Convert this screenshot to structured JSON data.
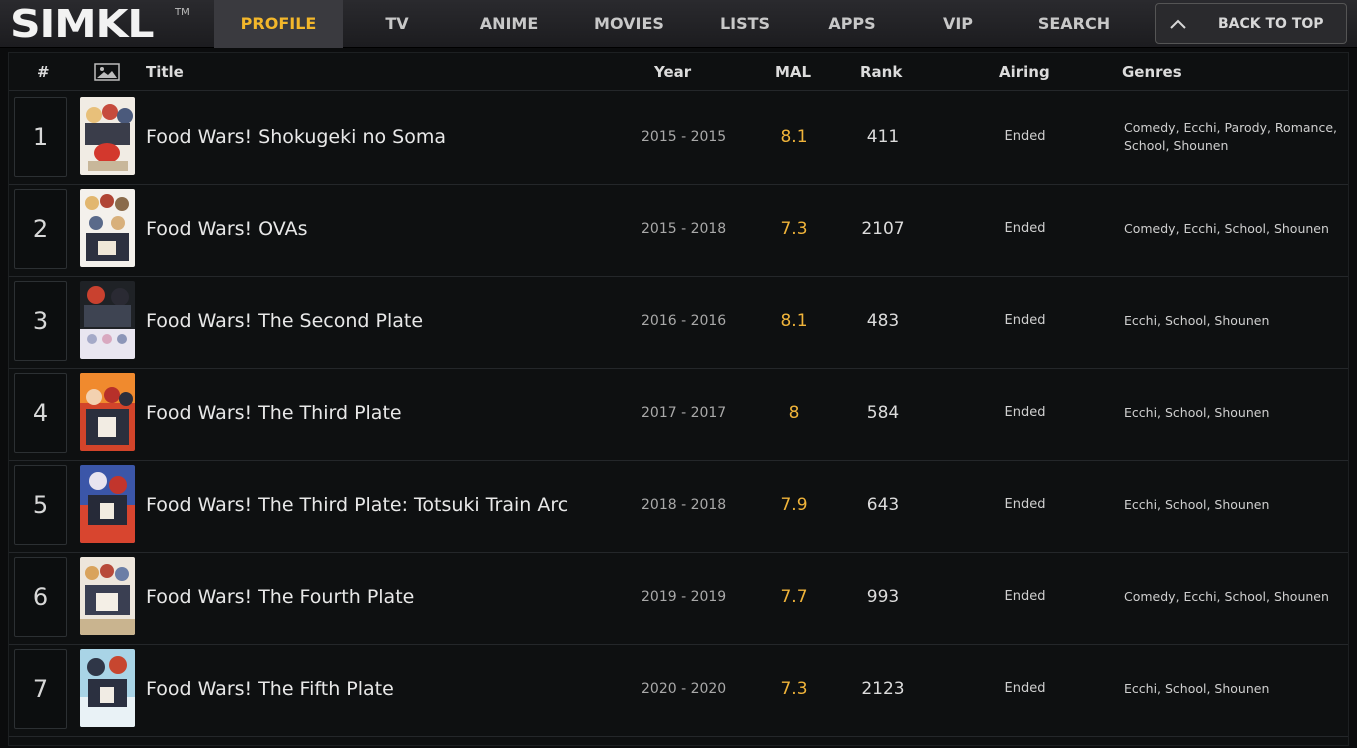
{
  "header": {
    "logo": "SIMKL",
    "logo_tm": "TM",
    "nav": [
      {
        "id": "profile",
        "label": "PROFILE",
        "active": true
      },
      {
        "id": "tv",
        "label": "TV",
        "active": false
      },
      {
        "id": "anime",
        "label": "ANIME",
        "active": false
      },
      {
        "id": "movies",
        "label": "MOVIES",
        "active": false
      },
      {
        "id": "lists",
        "label": "LISTS",
        "active": false
      },
      {
        "id": "apps",
        "label": "APPS",
        "active": false
      },
      {
        "id": "vip",
        "label": "VIP",
        "active": false
      },
      {
        "id": "search",
        "label": "SEARCH",
        "active": false
      }
    ],
    "back_to_top": "BACK TO TOP"
  },
  "table": {
    "columns": {
      "num": "#",
      "title": "Title",
      "year": "Year",
      "mal": "MAL",
      "rank": "Rank",
      "airing": "Airing",
      "genres": "Genres"
    },
    "rows": [
      {
        "num": "1",
        "title": "Food Wars! Shokugeki no Soma",
        "year": "2015 - 2015",
        "mal": "8.1",
        "rank": "411",
        "airing": "Ended",
        "genres": "Comedy, Ecchi, Parody, Romance, School, Shounen"
      },
      {
        "num": "2",
        "title": "Food Wars! OVAs",
        "year": "2015 - 2018",
        "mal": "7.3",
        "rank": "2107",
        "airing": "Ended",
        "genres": "Comedy, Ecchi, School, Shounen"
      },
      {
        "num": "3",
        "title": "Food Wars! The Second Plate",
        "year": "2016 - 2016",
        "mal": "8.1",
        "rank": "483",
        "airing": "Ended",
        "genres": "Ecchi, School, Shounen"
      },
      {
        "num": "4",
        "title": "Food Wars! The Third Plate",
        "year": "2017 - 2017",
        "mal": "8",
        "rank": "584",
        "airing": "Ended",
        "genres": "Ecchi, School, Shounen"
      },
      {
        "num": "5",
        "title": "Food Wars! The Third Plate: Totsuki Train Arc",
        "year": "2018 - 2018",
        "mal": "7.9",
        "rank": "643",
        "airing": "Ended",
        "genres": "Ecchi, School, Shounen"
      },
      {
        "num": "6",
        "title": "Food Wars! The Fourth Plate",
        "year": "2019 - 2019",
        "mal": "7.7",
        "rank": "993",
        "airing": "Ended",
        "genres": "Comedy, Ecchi, School, Shounen"
      },
      {
        "num": "7",
        "title": "Food Wars! The Fifth Plate",
        "year": "2020 - 2020",
        "mal": "7.3",
        "rank": "2123",
        "airing": "Ended",
        "genres": "Ecchi, School, Shounen"
      }
    ]
  },
  "colors": {
    "accent": "#f3b72b",
    "mal_score": "#f0b43a",
    "background": "#0b0c0d"
  }
}
